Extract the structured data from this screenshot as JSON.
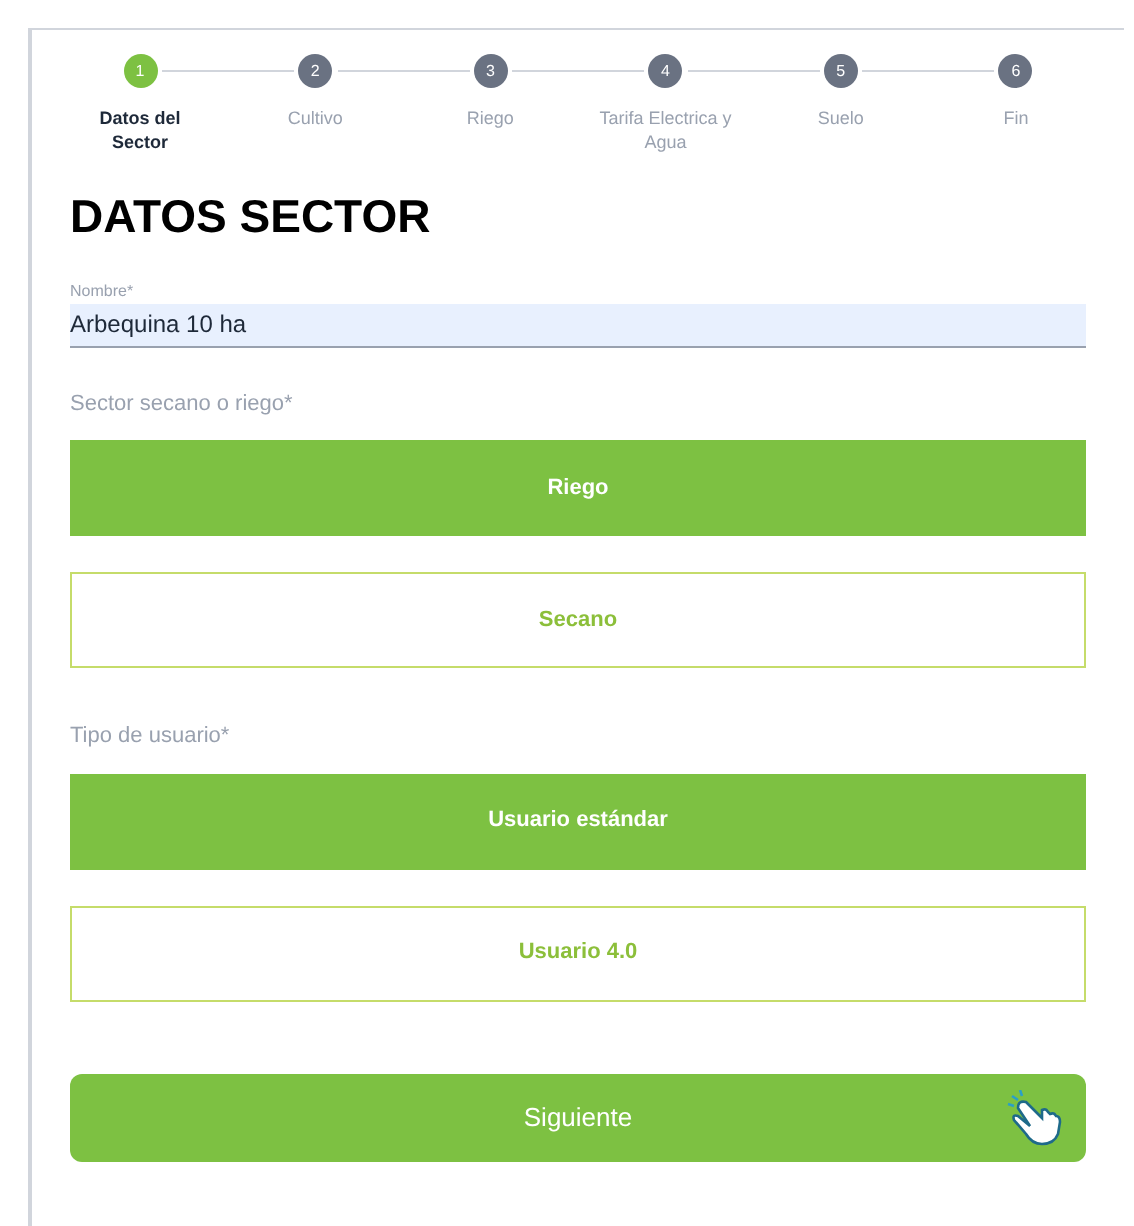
{
  "steps": [
    {
      "number": "1",
      "label": "Datos del Sector",
      "selected": true
    },
    {
      "number": "2",
      "label": "Cultivo",
      "selected": false
    },
    {
      "number": "3",
      "label": "Riego",
      "selected": false
    },
    {
      "number": "4",
      "label": "Tarifa Electrica y Agua",
      "selected": false
    },
    {
      "number": "5",
      "label": "Suelo",
      "selected": false
    },
    {
      "number": "6",
      "label": "Fin",
      "selected": false
    }
  ],
  "title": "DATOS SECTOR",
  "name_field": {
    "label": "Nombre*",
    "value": "Arbequina 10 ha"
  },
  "groups": [
    {
      "label": "Sector secano o riego*",
      "options": [
        {
          "label": "Riego",
          "selected": true
        },
        {
          "label": "Secano",
          "selected": false
        }
      ]
    },
    {
      "label": "Tipo de usuario*",
      "options": [
        {
          "label": "Usuario estándar",
          "selected": true
        },
        {
          "label": "Usuario 4.0",
          "selected": false
        }
      ]
    }
  ],
  "next_button": "Siguiente"
}
